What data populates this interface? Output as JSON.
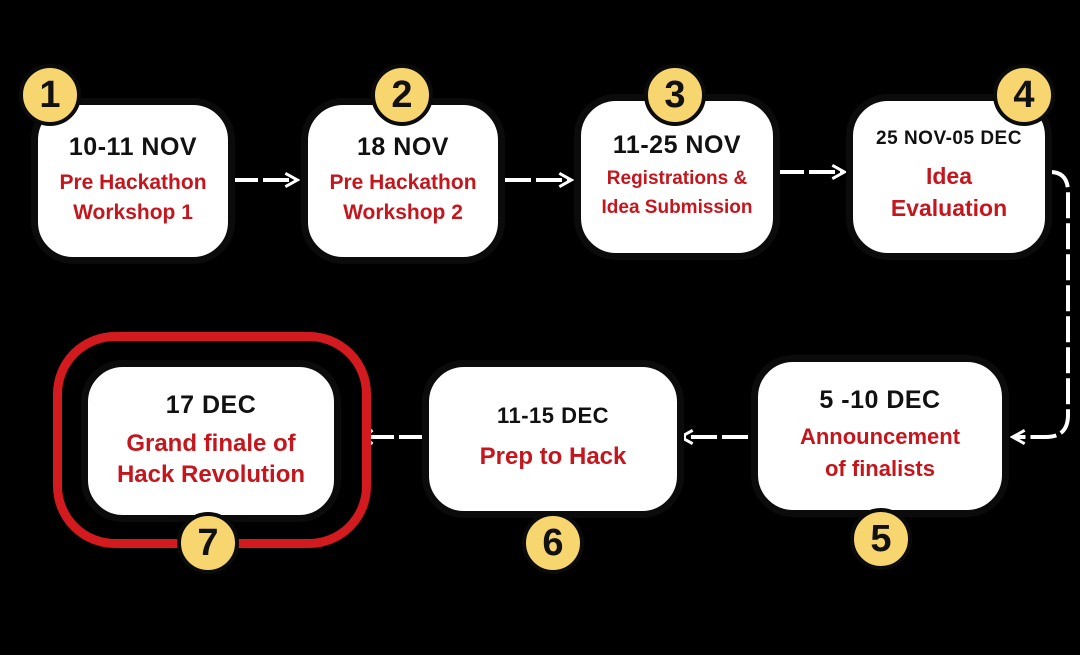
{
  "steps": [
    {
      "number": "1",
      "date": "10-11 NOV",
      "title": [
        "Pre Hackathon",
        "Workshop 1"
      ]
    },
    {
      "number": "2",
      "date": "18 NOV",
      "title": [
        "Pre Hackathon",
        "Workshop 2"
      ]
    },
    {
      "number": "3",
      "date": "11-25 NOV",
      "title": [
        "Registrations &",
        "Idea Submission"
      ]
    },
    {
      "number": "4",
      "date": "25 NOV-05 DEC",
      "title": [
        "Idea",
        "Evaluation"
      ]
    },
    {
      "number": "5",
      "date": "5 -10 DEC",
      "title": [
        "Announcement",
        "of finalists"
      ]
    },
    {
      "number": "6",
      "date": "11-15 DEC",
      "title": [
        "Prep to Hack"
      ]
    },
    {
      "number": "7",
      "date": "17 DEC",
      "title": [
        "Grand finale of",
        "Hack Revolution"
      ]
    }
  ],
  "colors": {
    "background": "#000000",
    "card": "#ffffff",
    "title_text": "#c4161c",
    "badge": "#f7d56f",
    "highlight_ring": "#d31a1f",
    "connector": "#ffffff"
  }
}
